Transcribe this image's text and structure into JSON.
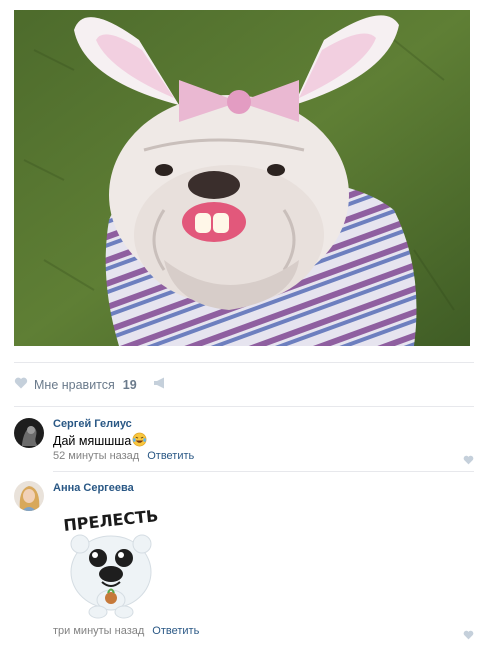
{
  "post": {
    "photo_alt": "photo",
    "likes": {
      "label": "Мне нравится",
      "count": "19"
    }
  },
  "comments": [
    {
      "author": "Сергей Гелиус",
      "text": "Дай мяшшша",
      "emoji": "laughing-tears",
      "time": "52 минуты назад",
      "reply_label": "Ответить"
    },
    {
      "author": "Анна Сергеева",
      "sticker_text": "ПРЕЛЕСТЬ",
      "time": "три минуты назад",
      "reply_label": "Ответить"
    }
  ],
  "colors": {
    "link": "#2a5885",
    "muted": "#828282",
    "icon": "#c5d0db"
  },
  "icons": [
    "heart-icon",
    "megaphone-icon"
  ]
}
